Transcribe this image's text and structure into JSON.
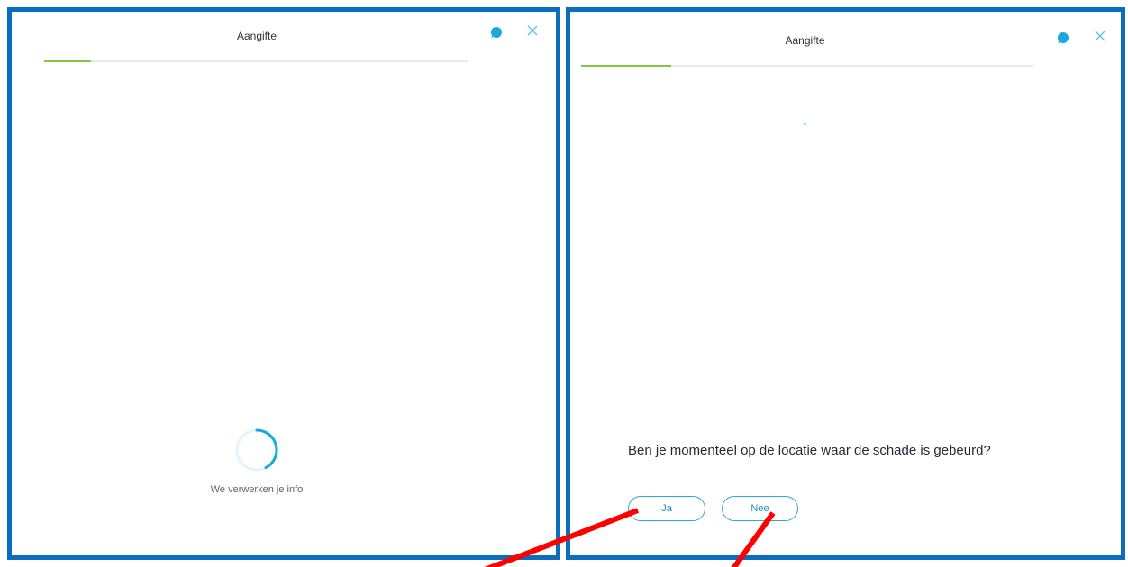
{
  "left_panel": {
    "title": "Aangifte",
    "progress_fraction": 0.11,
    "loading_text": "We verwerken je info",
    "icons": [
      "chat-icon",
      "close-icon",
      "loading-spinner"
    ]
  },
  "right_panel": {
    "title": "Aangifte",
    "progress_fraction": 0.2,
    "scroll_up_glyph": "↑",
    "question": "Ben je momenteel op de locatie waar de schade is gebeurd?",
    "answers": [
      {
        "label": "Ja"
      },
      {
        "label": "Nee"
      }
    ],
    "icons": [
      "chat-icon",
      "close-icon",
      "up-arrow-icon"
    ]
  },
  "colors": {
    "panel_border": "#0a6ebd",
    "progress_fill": "#8cc63f",
    "accent": "#1ba7df",
    "annotation_line": "#ff0000"
  }
}
